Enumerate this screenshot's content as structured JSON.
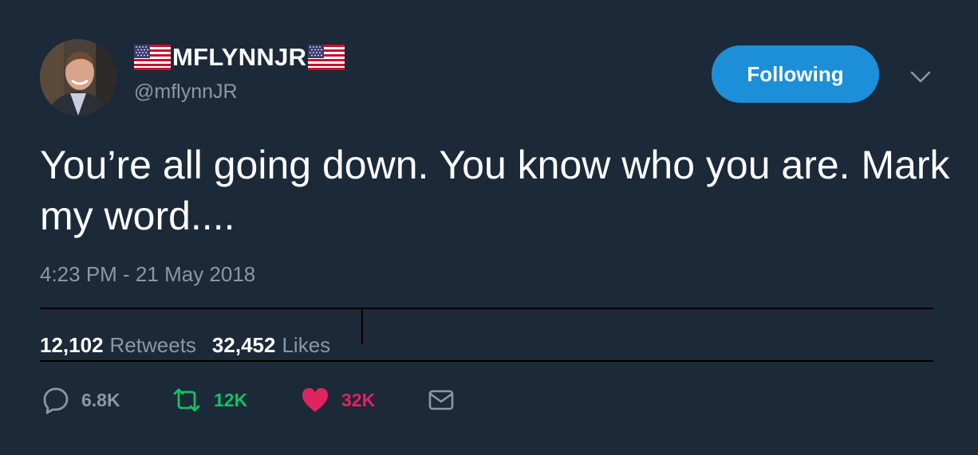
{
  "user": {
    "display_name": "MFLYNNJR",
    "handle": "@mflynnJR",
    "name_prefix_icon": "us-flag-icon",
    "name_suffix_icon": "us-flag-icon"
  },
  "follow_button": {
    "label": "Following",
    "color": "#1d8fd9"
  },
  "menu_icon": "chevron-down-icon",
  "tweet": {
    "text": "You’re all going down. You know who you are. Mark my word....",
    "timestamp": "4:23 PM - 21 May 2018"
  },
  "stats": {
    "retweets_count": "12,102",
    "retweets_label": "Retweets",
    "likes_count": "32,452",
    "likes_label": "Likes"
  },
  "actions": {
    "reply_count": "6.8K",
    "retweet_count": "12K",
    "like_count": "32K",
    "icons": [
      "reply-icon",
      "retweet-icon",
      "heart-icon",
      "message-icon"
    ]
  },
  "colors": {
    "background": "#1c2938",
    "text_secondary": "#8899a6",
    "retweet": "#17bf63",
    "like": "#e0245e"
  }
}
